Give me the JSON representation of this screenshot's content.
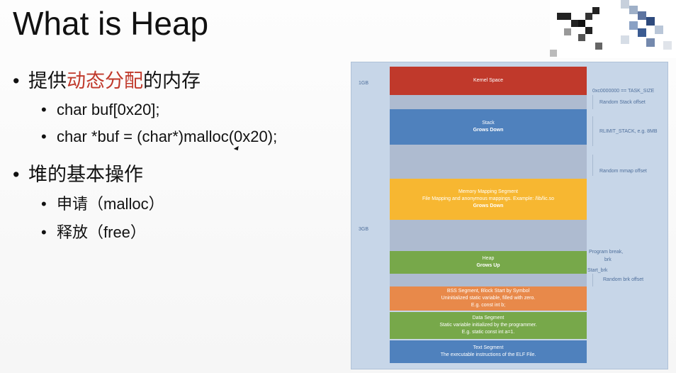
{
  "slide": {
    "title": "What is Heap",
    "bullets": {
      "b1_prefix": "提供",
      "b1_highlight": "动态分配",
      "b1_suffix": "的内存",
      "b1_sub1": "char buf[0x20];",
      "b1_sub2": "char *buf = (char*)malloc(0x20);",
      "b2": "堆的基本操作",
      "b2_sub1": "申请（malloc）",
      "b2_sub2": "释放（free）"
    },
    "highlight_color": "#c0392b"
  },
  "diagram": {
    "side_labels": {
      "top": "1GB",
      "bottom": "3GB"
    },
    "segments": {
      "kernel": "Kernel Space",
      "stack_title": "Stack",
      "stack_dir": "Grows Down",
      "mmap_title": "Memory Mapping Segment",
      "mmap_desc": "File Mapping and anonymous mappings. Example: /lib/lic.so",
      "mmap_dir": "Grows Down",
      "heap_title": "Heap",
      "heap_dir": "Grows Up",
      "bss_title": "BSS Segment, Block Start by Symbol",
      "bss_desc1": "Uninitialized static variable, filled with zero.",
      "bss_desc2": "E.g. const int b;",
      "data_title": "Data Segment",
      "data_desc1": "Static variable initialized by the programmer.",
      "data_desc2": "E.g. static const int a=1.",
      "text_title": "Text Segment",
      "text_desc": "The executable instructions of the ELF File."
    },
    "annotations": {
      "task_size": "0xc0000000 == TASK_SIZE",
      "random_stack": "Random Stack offset",
      "rlimit": "RLIMIT_STACK, e.g. 8MB",
      "random_mmap": "Random mmap offset",
      "program_break_1": "Program break,",
      "program_break_2": "brk",
      "start_brk": "Start_brk",
      "random_brk": "Random brk offset"
    },
    "colors": {
      "kernel": "#c0392b",
      "gap": "#aebbd0",
      "stack": "#4f81bd",
      "mmap": "#f7b731",
      "heap": "#77a84a",
      "bss": "#e8894a",
      "data": "#77a84a",
      "text": "#4f81bd"
    }
  }
}
